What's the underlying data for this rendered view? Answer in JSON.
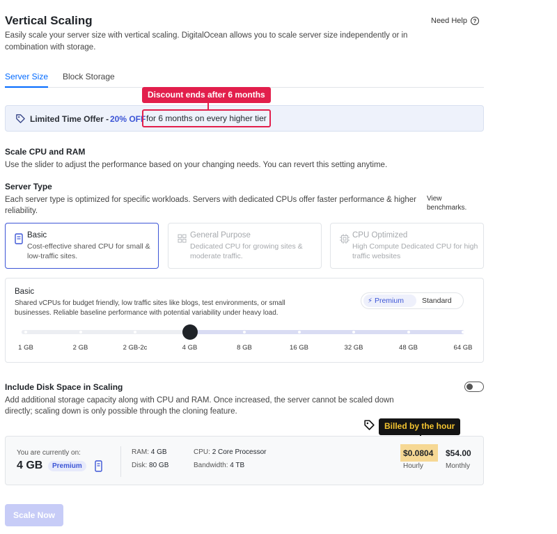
{
  "page": {
    "title": "Vertical Scaling",
    "help_label": "Need Help",
    "subtitle": "Easily scale your server size with vertical scaling. DigitalOcean allows you to scale server size independently or in combination with storage."
  },
  "tabs": [
    {
      "label": "Server Size",
      "active": true
    },
    {
      "label": "Block Storage",
      "active": false
    }
  ],
  "annotations": {
    "discount": "Discount ends after 6 months",
    "billing": "Billed by the hour"
  },
  "offer": {
    "prefix": "Limited Time Offer - ",
    "percent": "20% OFF",
    "rest": "for 6 months on every higher tier"
  },
  "scale_section": {
    "title": "Scale CPU and RAM",
    "description": "Use the slider to adjust the performance based on your changing needs. You can revert this setting anytime."
  },
  "server_type": {
    "title": "Server Type",
    "description": "Each server type is optimized for specific workloads. Servers with dedicated CPUs offer faster performance & higher reliability.",
    "benchmarks_link": "View benchmarks.",
    "cards": [
      {
        "name": "Basic",
        "description": "Cost-effective shared CPU for small & low-traffic sites.",
        "selected": true,
        "disabled": false
      },
      {
        "name": "General Purpose",
        "description": "Dedicated CPU for growing sites & moderate traffic.",
        "selected": false,
        "disabled": true
      },
      {
        "name": "CPU Optimized",
        "description": "High Compute Dedicated CPU for high traffic websites",
        "selected": false,
        "disabled": true
      }
    ]
  },
  "slider": {
    "title": "Basic",
    "description": "Shared vCPUs for budget friendly, low traffic sites like blogs, test environments, or small businesses. Reliable baseline performance with potential variability under heavy load.",
    "plan_options": [
      "Premium",
      "Standard"
    ],
    "selected_plan": "Premium",
    "sizes": [
      "1 GB",
      "2 GB",
      "2 GB-2c",
      "4 GB",
      "8 GB",
      "16 GB",
      "32 GB",
      "48 GB",
      "64 GB"
    ],
    "selected_size": "4 GB",
    "selected_index": 3
  },
  "disk": {
    "title": "Include Disk Space in Scaling",
    "description": "Add additional storage capacity along with CPU and RAM. Once increased, the server cannot be scaled down directly; scaling down is only possible through the cloning feature.",
    "enabled": false
  },
  "summary": {
    "current_label": "You are currently on:",
    "current_size": "4 GB",
    "current_plan": "Premium",
    "ram_label": "RAM:",
    "ram_value": "4 GB",
    "disk_label": "Disk:",
    "disk_value": "80 GB",
    "cpu_label": "CPU:",
    "cpu_value": "2 Core Processor",
    "bandwidth_label": "Bandwidth:",
    "bandwidth_value": "4 TB",
    "hourly_price": "$0.0804",
    "hourly_label": "Hourly",
    "monthly_price": "$54.00",
    "monthly_label": "Monthly"
  },
  "actions": {
    "scale_button": "Scale Now"
  },
  "colors": {
    "accent": "#3c55d6",
    "link": "#0069ff",
    "callout_red": "#e21f4c",
    "price_highlight": "#f6d894",
    "billing_callout_text": "#f4c430"
  }
}
